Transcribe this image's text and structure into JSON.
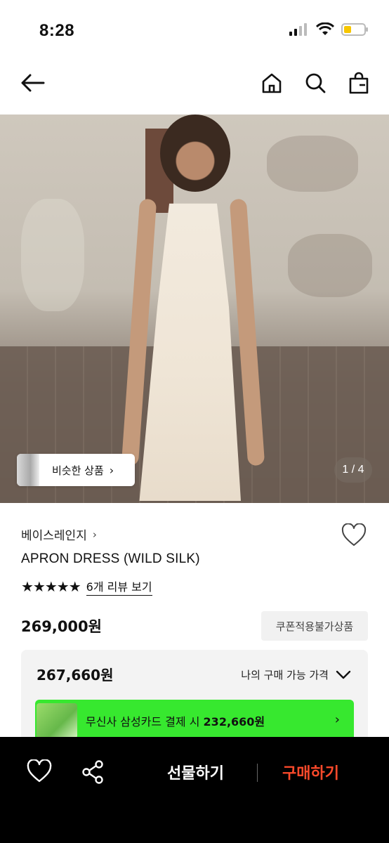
{
  "status_bar": {
    "time": "8:28"
  },
  "nav": {
    "back_icon": "arrow-left-icon",
    "home_icon": "home-icon",
    "search_icon": "search-icon",
    "cart_icon": "shopping-bag-icon"
  },
  "gallery": {
    "similar_products_label": "비슷한 상품",
    "page_indicator": "1 / 4"
  },
  "product": {
    "brand": "베이스레인지",
    "title": "APRON DRESS (WILD SILK)",
    "rating_stars": "★★★★★",
    "review_link": "6개 리뷰 보기",
    "price": "269,000원",
    "coupon_badge": "쿠폰적용불가상품"
  },
  "price_box": {
    "my_price": "267,660원",
    "my_price_label": "나의 구매 가능 가격"
  },
  "card_banner": {
    "text_prefix": "무신사 삼성카드 결제 시 ",
    "text_price": "232,660원",
    "color": "#37e82f"
  },
  "bottom_bar": {
    "gift_label": "선물하기",
    "buy_label": "구매하기",
    "buy_color": "#ff4a2b"
  }
}
